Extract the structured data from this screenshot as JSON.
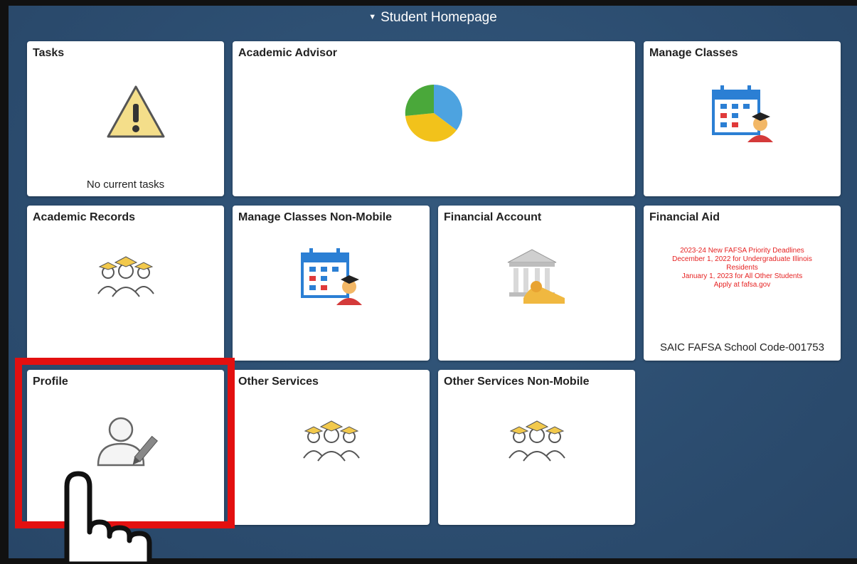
{
  "header": {
    "title": "Student Homepage"
  },
  "tiles": {
    "tasks": {
      "title": "Tasks",
      "note": "No current tasks"
    },
    "academic_advisor": {
      "title": "Academic Advisor"
    },
    "manage_classes": {
      "title": "Manage Classes"
    },
    "academic_records": {
      "title": "Academic Records"
    },
    "manage_classes_non_mobile": {
      "title": "Manage Classes Non-Mobile"
    },
    "financial_account": {
      "title": "Financial Account"
    },
    "financial_aid": {
      "title": "Financial Aid",
      "notice_lines": [
        "2023-24 New FAFSA Priority Deadlines",
        "December 1, 2022 for Undergraduate Illinois",
        "Residents",
        "January 1, 2023 for All Other Students",
        "Apply at fafsa.gov"
      ],
      "school_code": "SAIC FAFSA School Code-001753"
    },
    "profile": {
      "title": "Profile"
    },
    "other_services": {
      "title": "Other Services"
    },
    "other_services_non_mobile": {
      "title": "Other Services Non-Mobile"
    }
  },
  "colors": {
    "background_page": "#2f5275",
    "highlight": "#e31010",
    "notice_text": "#e62323"
  },
  "icons": {
    "tasks": "warning-icon",
    "academic_advisor": "pie-chart-icon",
    "manage_classes": "calendar-student-icon",
    "academic_records": "graduates-icon",
    "financial_account": "bank-icon",
    "profile": "user-edit-icon",
    "pointer": "pointing-hand-icon"
  }
}
